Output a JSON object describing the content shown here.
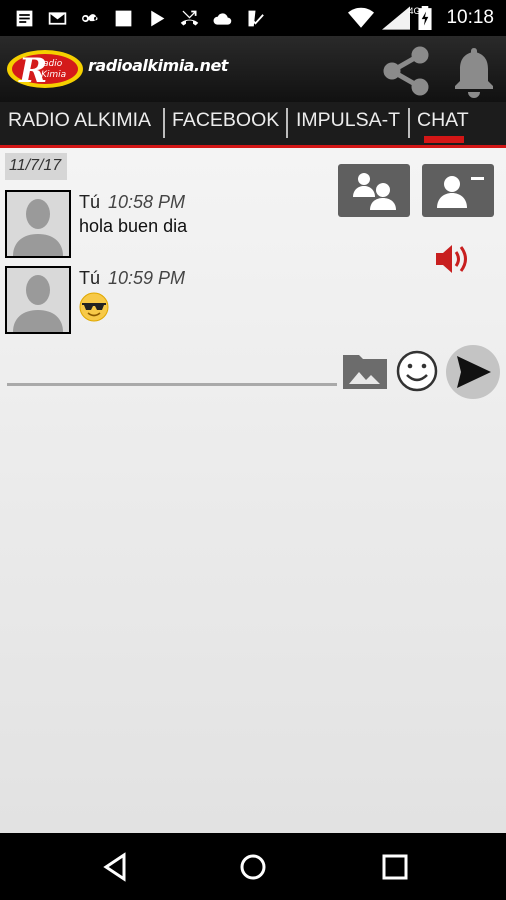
{
  "status_bar": {
    "time": "10:18",
    "network_label": "4G",
    "notification_icons": [
      "news-icon",
      "gmail-icon",
      "voicemail-icon",
      "image-icon",
      "play-icon",
      "missed-call-icon",
      "cloud-icon",
      "check-shield-icon"
    ],
    "system_icons": [
      "wifi-icon",
      "signal-icon",
      "battery-charging-icon"
    ]
  },
  "app_bar": {
    "site_name": "radioalkimia.net",
    "logo_text": "Radio Kimia"
  },
  "tabs": [
    {
      "label": "RADIO ALKIMIA",
      "active": false
    },
    {
      "label": "FACEBOOK",
      "active": false
    },
    {
      "label": "IMPULSA-T",
      "active": false
    },
    {
      "label": "CHAT",
      "active": true
    }
  ],
  "chat": {
    "date": "11/7/17",
    "messages": [
      {
        "sender": "Tú",
        "time": "10:58 PM",
        "text": "hola buen dia"
      },
      {
        "sender": "Tú",
        "time": "10:59 PM",
        "emoji": "sunglasses-emoji"
      }
    ],
    "input_value": ""
  },
  "colors": {
    "accent": "#d31616",
    "tab_bar": "#1c1c1c",
    "button_grey": "#5f5f5f",
    "content_bg": "#ececec"
  }
}
